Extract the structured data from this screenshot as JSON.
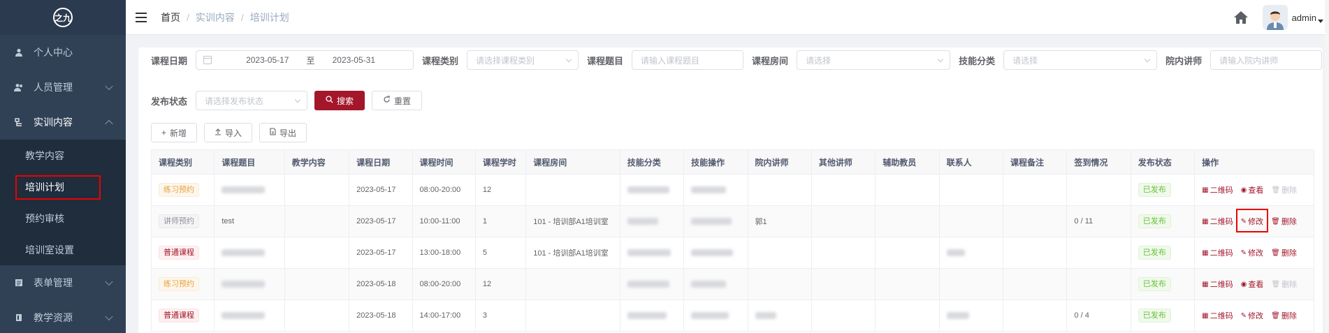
{
  "sidebar": {
    "logo": "之九",
    "items": [
      {
        "label": "个人中心",
        "icon": "user-icon"
      },
      {
        "label": "人员管理",
        "icon": "users-icon"
      },
      {
        "label": "实训内容",
        "icon": "content-icon"
      },
      {
        "label": "表单管理",
        "icon": "form-icon"
      },
      {
        "label": "教学资源",
        "icon": "resource-icon"
      }
    ],
    "submenu": [
      "教学内容",
      "培训计划",
      "预约审核",
      "培训室设置"
    ]
  },
  "breadcrumb": [
    "首页",
    "实训内容",
    "培训计划"
  ],
  "header": {
    "username": "admin"
  },
  "search": {
    "course_date_label": "课程日期",
    "date_start": "2023-05-17",
    "date_sep": "至",
    "date_end": "2023-05-31",
    "course_type_label": "课程类别",
    "course_type_placeholder": "请选择课程类别",
    "course_title_label": "课程题目",
    "course_title_placeholder": "请输入课程题目",
    "room_label": "课程房间",
    "room_placeholder": "请选择",
    "skill_label": "技能分类",
    "skill_placeholder": "请选择",
    "teacher_label": "院内讲师",
    "teacher_placeholder": "请输入院内讲师",
    "status_label": "发布状态",
    "status_placeholder": "请选择发布状态",
    "search_button": "搜索",
    "reset_button": "重置"
  },
  "toolbar": {
    "add": "新增",
    "import": "导入",
    "export": "导出"
  },
  "table": {
    "headers": [
      "课程类别",
      "课程题目",
      "教学内容",
      "课程日期",
      "课程时间",
      "课程学时",
      "课程房间",
      "技能分类",
      "技能操作",
      "院内讲师",
      "其他讲师",
      "辅助教员",
      "联系人",
      "课程备注",
      "签到情况",
      "发布状态",
      "操作"
    ],
    "rows": [
      {
        "type": "练习预约",
        "title": "",
        "date": "2023-05-17",
        "time": "08:00-20:00",
        "hours": "12",
        "room": "",
        "teacher": "",
        "signin": "",
        "status": "已发布",
        "ops": [
          "二维码",
          "查看",
          "删除"
        ]
      },
      {
        "type": "讲师预约",
        "title": "test",
        "date": "2023-05-17",
        "time": "10:00-11:00",
        "hours": "1",
        "room": "101 - 培训部A1培训室",
        "teacher": "郭1",
        "signin": "0 / 11",
        "status": "已发布",
        "ops": [
          "二维码",
          "修改",
          "删除"
        ]
      },
      {
        "type": "普通课程",
        "title": "",
        "date": "2023-05-17",
        "time": "13:00-18:00",
        "hours": "5",
        "room": "101 - 培训部A1培训室",
        "teacher": "",
        "signin": "",
        "status": "已发布",
        "ops": [
          "二维码",
          "修改",
          "删除"
        ]
      },
      {
        "type": "练习预约",
        "title": "",
        "date": "2023-05-18",
        "time": "08:00-20:00",
        "hours": "12",
        "room": "",
        "teacher": "",
        "signin": "",
        "status": "已发布",
        "ops": [
          "二维码",
          "查看",
          "删除"
        ]
      },
      {
        "type": "普通课程",
        "title": "",
        "date": "2023-05-18",
        "time": "14:00-17:00",
        "hours": "3",
        "room": "",
        "teacher": "",
        "signin": "0 / 4",
        "status": "已发布",
        "ops": [
          "二维码",
          "修改",
          "删除"
        ]
      }
    ]
  },
  "colors": {
    "sidebar": "#304156",
    "accent": "#a4162a",
    "highlight": "#ee0000"
  }
}
